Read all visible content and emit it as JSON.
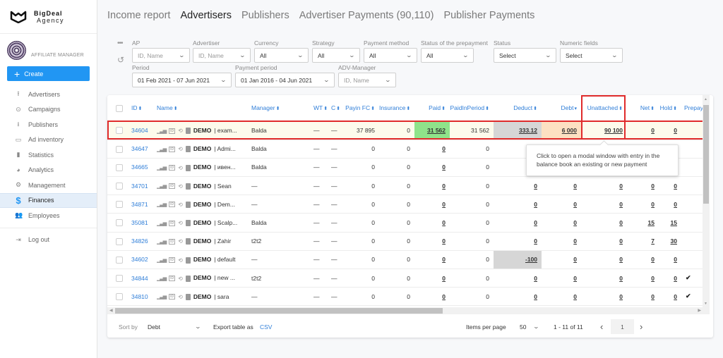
{
  "brand": {
    "name_line1": "BigDeal",
    "name_line2": "Agency"
  },
  "profile": {
    "role": "AFFILIATE MANAGER"
  },
  "sidebar": {
    "create_label": "Create",
    "items": [
      {
        "label": "Advertisers",
        "icon": "upload-icon"
      },
      {
        "label": "Campaigns",
        "icon": "play-circle-icon"
      },
      {
        "label": "Publishers",
        "icon": "download-icon"
      },
      {
        "label": "Ad inventory",
        "icon": "inventory-icon"
      },
      {
        "label": "Statistics",
        "icon": "bar-chart-icon"
      },
      {
        "label": "Analytics",
        "icon": "pie-chart-icon"
      },
      {
        "label": "Management",
        "icon": "gear-box-icon"
      },
      {
        "label": "Finances",
        "icon": "dollar-icon",
        "active": true
      },
      {
        "label": "Employees",
        "icon": "employees-icon"
      }
    ],
    "logout_label": "Log out"
  },
  "tabs": [
    {
      "label": "Income report"
    },
    {
      "label": "Advertisers",
      "active": true
    },
    {
      "label": "Publishers"
    },
    {
      "label": "Advertiser Payments (90,110)"
    },
    {
      "label": "Publisher Payments"
    }
  ],
  "filters": {
    "ap": {
      "label": "AP",
      "placeholder": "ID, Name"
    },
    "advertiser": {
      "label": "Advertiser",
      "placeholder": "ID, Name"
    },
    "currency": {
      "label": "Currency",
      "value": "All"
    },
    "strategy": {
      "label": "Strategy",
      "value": "All"
    },
    "payment_method": {
      "label": "Payment method",
      "value": "All"
    },
    "prepayment_status": {
      "label": "Status of the prepayment",
      "value": "All"
    },
    "status": {
      "label": "Status",
      "value": "Select"
    },
    "numeric_fields": {
      "label": "Numeric fields",
      "value": "Select"
    },
    "period": {
      "label": "Period",
      "value": "01 Feb 2021 - 07 Jun 2021"
    },
    "payment_period": {
      "label": "Payment period",
      "value": "01 Jan 2016 - 04 Jun 2021"
    },
    "adv_manager": {
      "label": "ADV-Manager",
      "placeholder": "ID, Name"
    }
  },
  "table": {
    "columns": {
      "id": "ID",
      "name": "Name",
      "manager": "Manager",
      "wt": "WT",
      "c": "C",
      "payin_fc": "Payin FC",
      "insurance": "Insurance",
      "paid": "Paid",
      "paid_in_period": "PaidInPeriod",
      "deduct": "Deduct",
      "debt": "Debt",
      "unattached": "Unattached",
      "net": "Net",
      "hold": "Hold",
      "prepay": "Prepay"
    },
    "rows": [
      {
        "id": "34604",
        "prefix": "DEMO",
        "name": "| exam...",
        "manager": "Balda",
        "wt": "—",
        "c": "—",
        "payin_fc": "37 895",
        "insurance": "0",
        "paid": "31 562",
        "paid_in_period": "31 562",
        "deduct": "333.12",
        "debt": "6 000",
        "unattached": "90 100",
        "net": "0",
        "hold": "0",
        "prepay": ""
      },
      {
        "id": "34647",
        "prefix": "DEMO",
        "name": "| Admi...",
        "manager": "Balda",
        "wt": "—",
        "c": "—",
        "payin_fc": "0",
        "insurance": "0",
        "paid": "0",
        "paid_in_period": "0",
        "deduct": "",
        "debt": "",
        "unattached": "",
        "net": "",
        "hold": "",
        "prepay": ""
      },
      {
        "id": "34665",
        "prefix": "DEMO",
        "name": "| ивен...",
        "manager": "Balda",
        "wt": "—",
        "c": "—",
        "payin_fc": "0",
        "insurance": "0",
        "paid": "0",
        "paid_in_period": "0",
        "deduct": "",
        "debt": "",
        "unattached": "",
        "net": "",
        "hold": "",
        "prepay": ""
      },
      {
        "id": "34701",
        "prefix": "DEMO",
        "name": "| Sean",
        "manager": "—",
        "wt": "—",
        "c": "—",
        "payin_fc": "0",
        "insurance": "0",
        "paid": "0",
        "paid_in_period": "0",
        "deduct": "0",
        "debt": "0",
        "unattached": "0",
        "net": "0",
        "hold": "0",
        "prepay": ""
      },
      {
        "id": "34871",
        "prefix": "DEMO",
        "name": "| Dem...",
        "manager": "—",
        "wt": "—",
        "c": "—",
        "payin_fc": "0",
        "insurance": "0",
        "paid": "0",
        "paid_in_period": "0",
        "deduct": "0",
        "debt": "0",
        "unattached": "0",
        "net": "0",
        "hold": "0",
        "prepay": ""
      },
      {
        "id": "35081",
        "prefix": "DEMO",
        "name": "| Scalp...",
        "manager": "Balda",
        "wt": "—",
        "c": "—",
        "payin_fc": "0",
        "insurance": "0",
        "paid": "0",
        "paid_in_period": "0",
        "deduct": "0",
        "debt": "0",
        "unattached": "0",
        "net": "15",
        "hold": "15",
        "prepay": ""
      },
      {
        "id": "34826",
        "prefix": "DEMO",
        "name": "| Zahir",
        "manager": "t2t2",
        "wt": "—",
        "c": "—",
        "payin_fc": "0",
        "insurance": "0",
        "paid": "0",
        "paid_in_period": "0",
        "deduct": "0",
        "debt": "0",
        "unattached": "0",
        "net": "7",
        "hold": "30",
        "prepay": ""
      },
      {
        "id": "34602",
        "prefix": "DEMO",
        "name": "| default",
        "manager": "—",
        "wt": "—",
        "c": "—",
        "payin_fc": "0",
        "insurance": "0",
        "paid": "0",
        "paid_in_period": "0",
        "deduct": "-100",
        "debt": "0",
        "unattached": "0",
        "net": "0",
        "hold": "0",
        "prepay": ""
      },
      {
        "id": "34844",
        "prefix": "DEMO",
        "name": "| new ...",
        "manager": "t2t2",
        "wt": "—",
        "c": "—",
        "payin_fc": "0",
        "insurance": "0",
        "paid": "0",
        "paid_in_period": "0",
        "deduct": "0",
        "debt": "0",
        "unattached": "0",
        "net": "0",
        "hold": "0",
        "prepay": "✔"
      },
      {
        "id": "34810",
        "prefix": "DEMO",
        "name": "| sara",
        "manager": "—",
        "wt": "—",
        "c": "—",
        "payin_fc": "0",
        "insurance": "0",
        "paid": "0",
        "paid_in_period": "0",
        "deduct": "0",
        "debt": "0",
        "unattached": "0",
        "net": "0",
        "hold": "0",
        "prepay": "✔"
      }
    ]
  },
  "tooltip": {
    "text": "Click to open a modal window with entry in the balance book an existing or new payment"
  },
  "footer": {
    "sort_label": "Sort by",
    "sort_value": "Debt",
    "export_label": "Export table as",
    "export_link": "CSV",
    "items_per_page_label": "Items per page",
    "items_per_page": "50",
    "range": "1 - 11 of 11",
    "current_page": "1"
  }
}
